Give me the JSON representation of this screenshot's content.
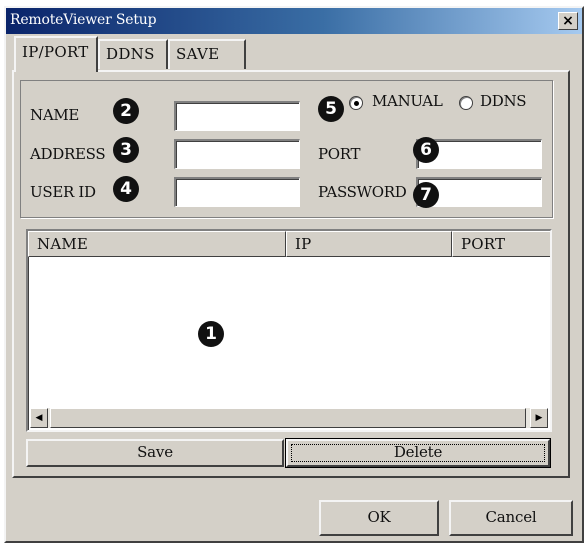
{
  "window": {
    "title": "RemoteViewer Setup",
    "close_glyph": "×"
  },
  "tabs": [
    {
      "label": "IP/PORT",
      "active": true
    },
    {
      "label": "DDNS",
      "active": false
    },
    {
      "label": "SAVE",
      "active": false
    }
  ],
  "form": {
    "name_label": "NAME",
    "address_label": "ADDRESS",
    "userid_label": "USER ID",
    "port_label": "PORT",
    "password_label": "PASSWORD",
    "name_value": "",
    "address_value": "",
    "userid_value": "",
    "port_value": "",
    "password_value": "",
    "mode": {
      "manual_label": "MANUAL",
      "ddns_label": "DDNS",
      "selected": "MANUAL"
    }
  },
  "callouts": [
    "1",
    "2",
    "3",
    "4",
    "5",
    "6",
    "7"
  ],
  "list": {
    "columns": [
      "NAME",
      "IP",
      "PORT"
    ],
    "rows": [],
    "scroll_left_icon": "◀",
    "scroll_right_icon": "▶"
  },
  "actions": {
    "save_label": "Save",
    "delete_label": "Delete"
  },
  "footer": {
    "ok_label": "OK",
    "cancel_label": "Cancel"
  },
  "colors": {
    "dialog_face": "#d4d0c8",
    "title_start": "#0a246a",
    "title_end": "#a6caf0",
    "callout": "#111111"
  }
}
